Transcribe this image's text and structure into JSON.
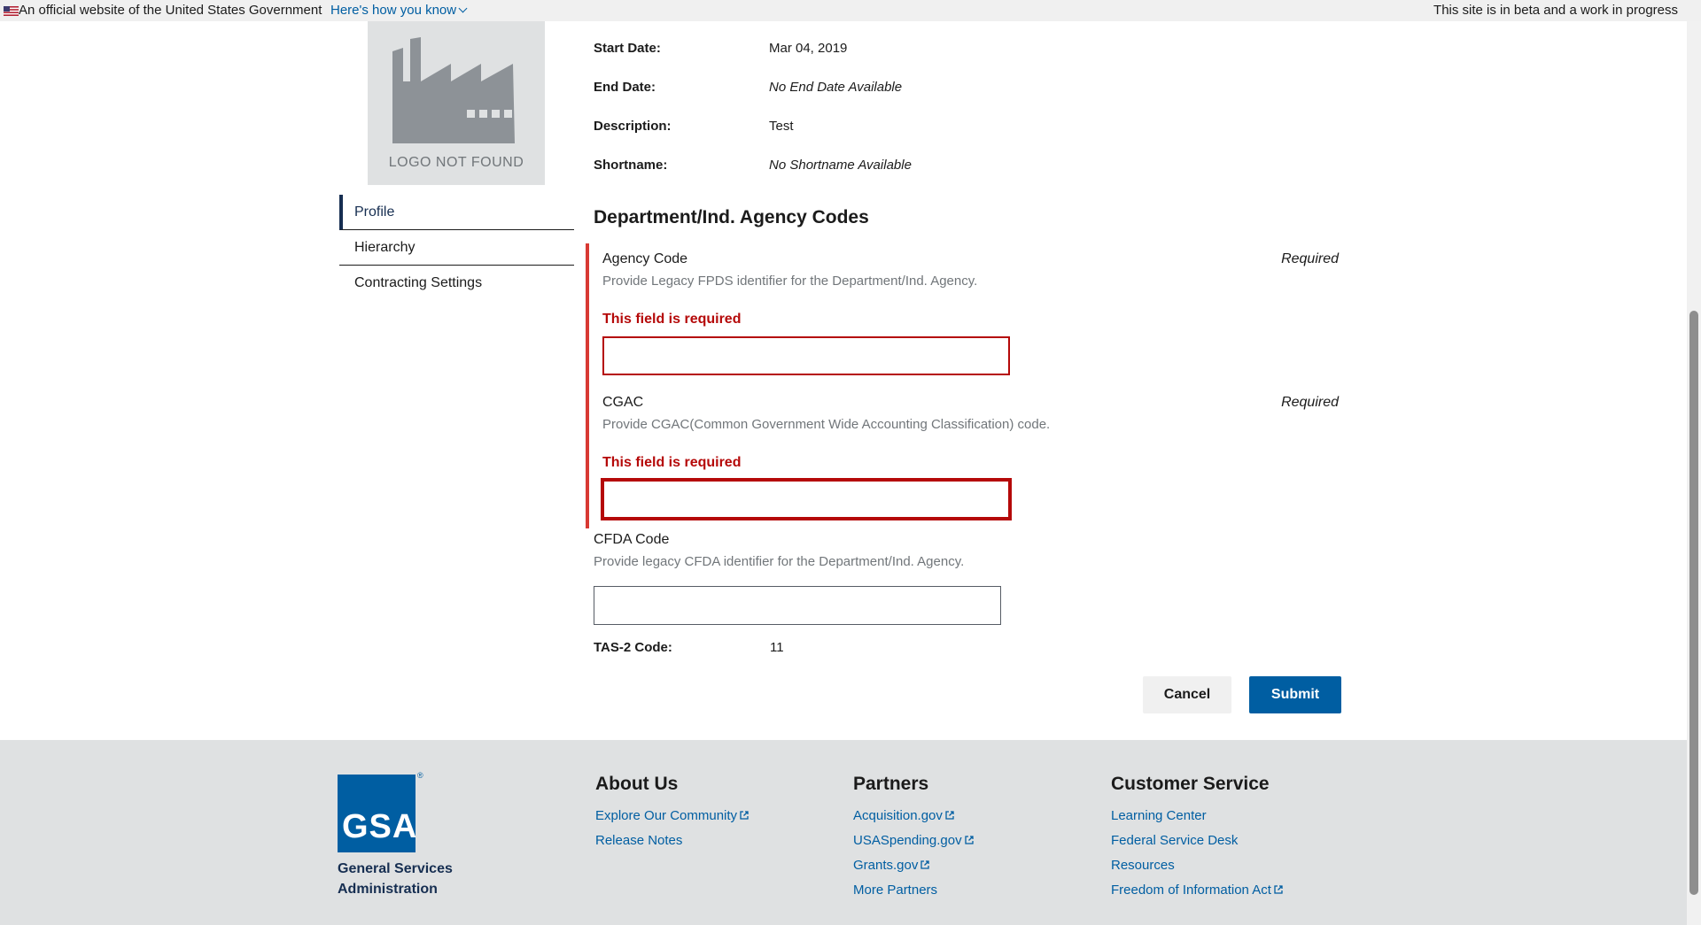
{
  "gov_banner": {
    "official_text": "An official website of the United States Government",
    "how_link": "Here's how you know",
    "beta_text": "This site is in beta and a work in progress"
  },
  "logo": {
    "placeholder_text": "LOGO NOT FOUND"
  },
  "sidenav": {
    "items": [
      {
        "label": "Profile"
      },
      {
        "label": "Hierarchy"
      },
      {
        "label": "Contracting Settings"
      }
    ]
  },
  "details": {
    "start_date_label": "Start Date:",
    "start_date_value": "Mar 04, 2019",
    "end_date_label": "End Date:",
    "end_date_value": "No End Date Available",
    "description_label": "Description:",
    "description_value": "Test",
    "shortname_label": "Shortname:",
    "shortname_value": "No Shortname Available"
  },
  "codes": {
    "heading": "Department/Ind. Agency Codes",
    "agency_code": {
      "label": "Agency Code",
      "hint": "Provide Legacy FPDS identifier for the Department/Ind. Agency.",
      "required": "Required",
      "error": "This field is required",
      "value": ""
    },
    "cgac": {
      "label": "CGAC",
      "hint": "Provide CGAC(Common Government Wide Accounting Classification) code.",
      "required": "Required",
      "error": "This field is required",
      "value": ""
    },
    "cfda": {
      "label": "CFDA Code",
      "hint": "Provide legacy CFDA identifier for the Department/Ind. Agency.",
      "value": ""
    },
    "tas2_label": "TAS-2 Code:",
    "tas2_value": "11"
  },
  "actions": {
    "cancel": "Cancel",
    "submit": "Submit"
  },
  "footer": {
    "org_abbr": "GSA",
    "org_name": "General Services Administration",
    "columns": [
      {
        "title": "About Us",
        "links": [
          "Explore Our Community",
          "Release Notes"
        ]
      },
      {
        "title": "Partners",
        "links": [
          "Acquisition.gov",
          "USASpending.gov",
          "Grants.gov",
          "More Partners"
        ]
      },
      {
        "title": "Customer Service",
        "links": [
          "Learning Center",
          "Federal Service Desk",
          "Resources",
          "Freedom of Information Act"
        ]
      }
    ]
  },
  "colors": {
    "primary": "#005ea2",
    "error": "#b50909",
    "error_border": "#d83933",
    "nav_active": "#162e51",
    "footer_bg": "#dfe1e2"
  }
}
